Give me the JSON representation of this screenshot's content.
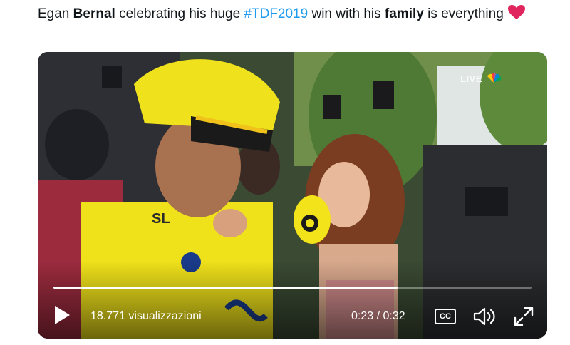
{
  "tweet": {
    "parts": [
      {
        "text": "Egan ",
        "style": "plain"
      },
      {
        "text": "Bernal",
        "style": "bold"
      },
      {
        "text": " celebrating his huge ",
        "style": "plain"
      },
      {
        "text": "#TDF2019",
        "style": "hashtag"
      },
      {
        "text": " win with his ",
        "style": "plain"
      },
      {
        "text": "family",
        "style": "bold"
      },
      {
        "text": " is everything ",
        "style": "plain"
      }
    ],
    "emoji": "heart-emoji"
  },
  "video": {
    "live_label": "LIVE",
    "broadcaster_icon": "nbc-peacock-icon",
    "views": "18.771 visualizzazioni",
    "time": "0:23 / 0:32",
    "cc_label": "CC",
    "progress": 0.72,
    "icons": {
      "play": "play-icon",
      "volume": "volume-icon",
      "fullscreen": "fullscreen-icon"
    }
  },
  "colors": {
    "hashtag": "#1d9bf0",
    "heart": "#e0245e",
    "jersey": "#f0e21a"
  }
}
